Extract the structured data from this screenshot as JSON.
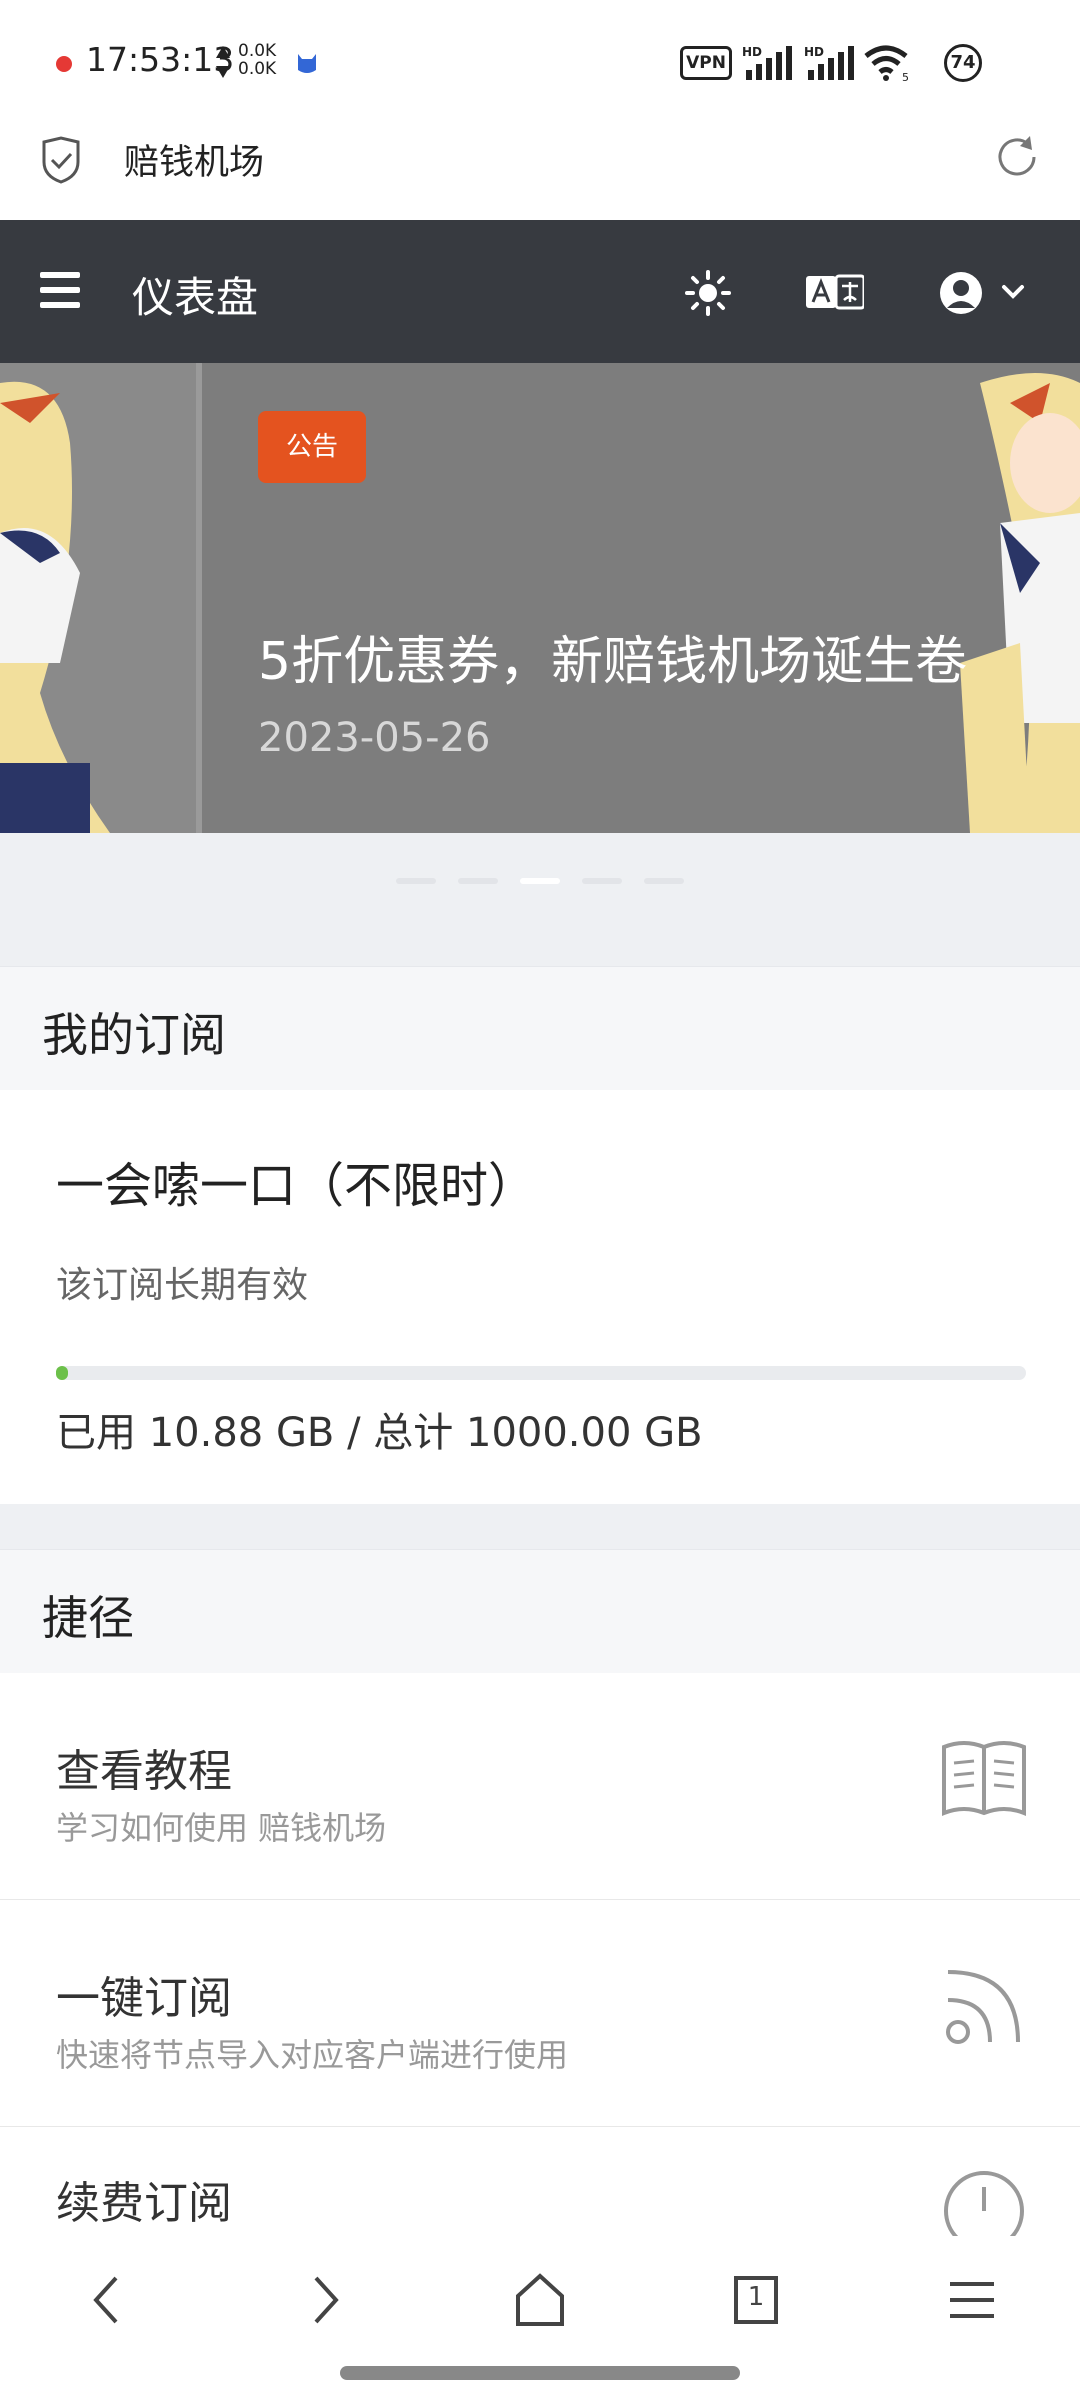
{
  "status_bar": {
    "time": "17:53:13",
    "net_up": "0.0K",
    "net_down": "0.0K",
    "vpn": "VPN",
    "sig1": "HD",
    "sig2": "HD",
    "wifi_sub": "5",
    "battery": "74"
  },
  "browser": {
    "title": "赔钱机场"
  },
  "app_header": {
    "title": "仪表盘"
  },
  "banner": {
    "tag": "公告",
    "headline": "5折优惠券，新赔钱机场诞生卷",
    "date": "2023-05-26",
    "total_slides": 5,
    "active_slide": 3
  },
  "subscription": {
    "section_title": "我的订阅",
    "plan_name": "一会嗦一口（不限时）",
    "validity": "该订阅长期有效",
    "used_gb": 10.88,
    "total_gb": 1000.0,
    "usage_text": "已用 10.88 GB / 总计 1000.00 GB"
  },
  "shortcuts": {
    "section_title": "捷径",
    "items": [
      {
        "title": "查看教程",
        "desc": "学习如何使用 赔钱机场",
        "icon": "book-icon"
      },
      {
        "title": "一键订阅",
        "desc": "快速将节点导入对应客户端进行使用",
        "icon": "rss-icon"
      },
      {
        "title": "续费订阅",
        "desc": "",
        "icon": "clock-icon"
      }
    ]
  },
  "bottom_nav": [
    "back-icon",
    "forward-icon",
    "home-icon",
    "tabs-icon",
    "menu-icon"
  ],
  "tabs_count": "1",
  "colors": {
    "header_bg": "#373a40",
    "tag_bg": "#e4531f",
    "progress": "#6cc04a"
  }
}
